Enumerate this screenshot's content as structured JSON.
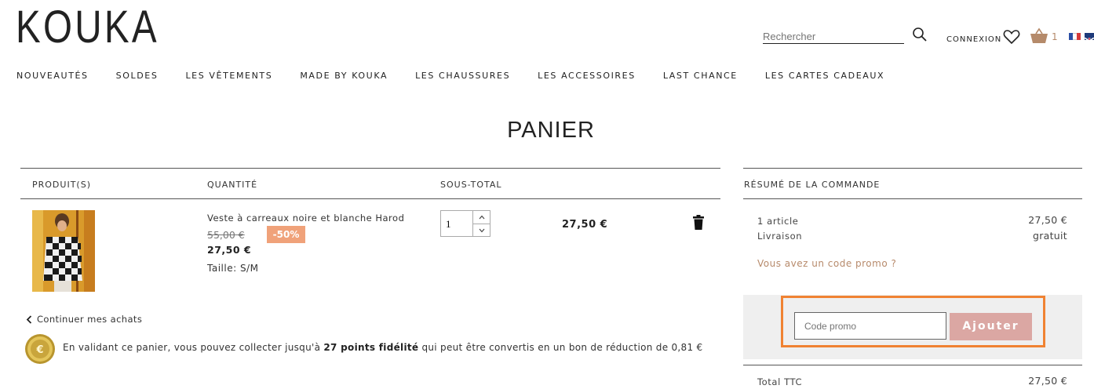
{
  "header": {
    "logo": "KOUKA",
    "search_placeholder": "Rechercher",
    "login_label": "CONNEXION",
    "basket_count": "1"
  },
  "nav": {
    "items": [
      "NOUVEAUTÉS",
      "SOLDES",
      "LES VÊTEMENTS",
      "MADE BY KOUKA",
      "LES CHAUSSURES",
      "LES ACCESSOIRES",
      "LAST CHANCE",
      "LES CARTES CADEAUX"
    ]
  },
  "page": {
    "title": "PANIER"
  },
  "cart": {
    "columns": [
      "PRODUIT(S)",
      "QUANTITÉ",
      "SOUS-TOTAL"
    ],
    "item": {
      "name": "Veste à carreaux noire et blanche Harod",
      "old_price": "55,00 €",
      "discount": "-50%",
      "price": "27,50 €",
      "size_label": "Taille: S/M",
      "quantity": "1",
      "subtotal": "27,50 €"
    },
    "continue_label": "Continuer mes achats",
    "fidelity": {
      "prefix": "En validant ce panier, vous pouvez collecter jusqu'à ",
      "points": "27 points fidélité",
      "suffix": " qui peut être convertis en un bon de réduction de 0,81 €"
    }
  },
  "summary": {
    "title": "RÉSUMÉ DE LA COMMANDE",
    "articles_label": "1 article",
    "articles_value": "27,50 €",
    "delivery_label": "Livraison",
    "delivery_value": "gratuit",
    "promo_link": "Vous avez un code promo ?",
    "promo_placeholder": "Code promo",
    "promo_button": "Ajouter",
    "total_label": "Total TTC",
    "total_value": "27,50 €"
  },
  "colors": {
    "accent": "#b78a6b",
    "discount_badge": "#f0a27a",
    "promo_button": "#dba7a3",
    "highlight_frame": "#f08232"
  }
}
